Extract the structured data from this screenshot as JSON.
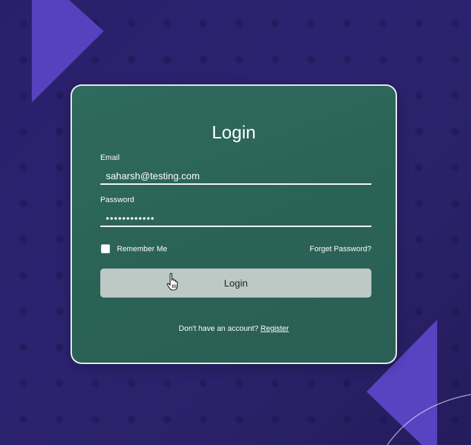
{
  "login_card": {
    "title": "Login",
    "email": {
      "label": "Email",
      "value": "saharsh@testing.com"
    },
    "password": {
      "label": "Password",
      "value": "••••••••••••"
    },
    "remember_label": "Remember Me",
    "remember_checked": false,
    "forget_link": "Forget Password?",
    "login_button": "Login",
    "register_prompt": "Don't have an account?",
    "register_link": "Register"
  },
  "colors": {
    "background": "#2a1f6b",
    "card": "#2d665a",
    "accent_shape": "#5b46c4",
    "button": "#bcc9c5"
  },
  "icons": {
    "cursor": "hand-pointer-icon"
  }
}
